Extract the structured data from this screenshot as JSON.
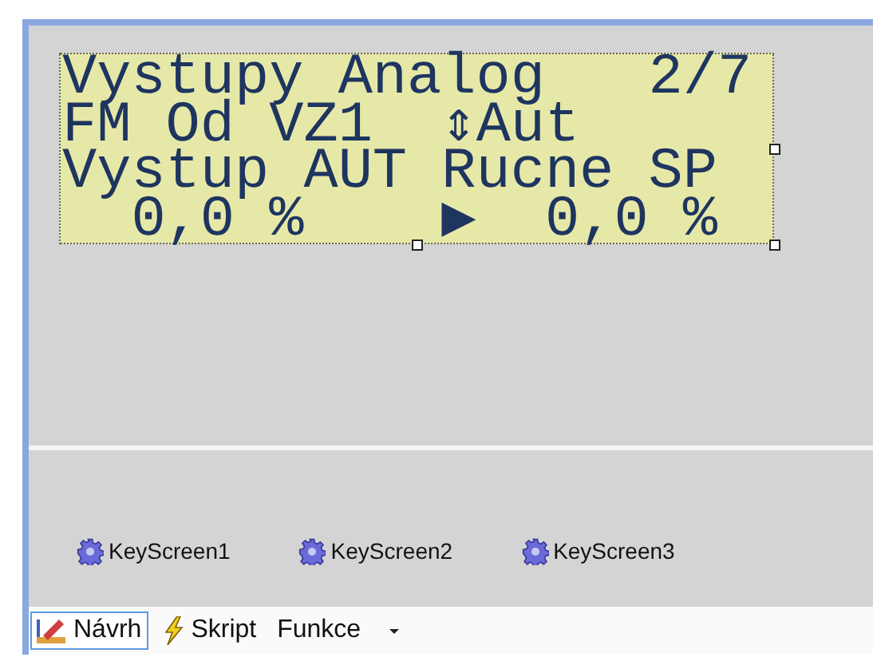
{
  "lcd": {
    "lines": [
      "Vystupy Analog   2/7",
      "FM Od VZ1  ⇕Aut",
      "Vystup AUT Rucne SP",
      "  0,0 %    ▶  0,0 %"
    ],
    "selected": true
  },
  "components": [
    {
      "label": "KeyScreen1"
    },
    {
      "label": "KeyScreen2"
    },
    {
      "label": "KeyScreen3"
    }
  ],
  "tabs": [
    {
      "label": "Návrh",
      "kind": "design",
      "selected": true
    },
    {
      "label": "Skript",
      "kind": "script",
      "selected": false
    },
    {
      "label": "Funkce",
      "kind": "menu",
      "selected": false
    }
  ]
}
